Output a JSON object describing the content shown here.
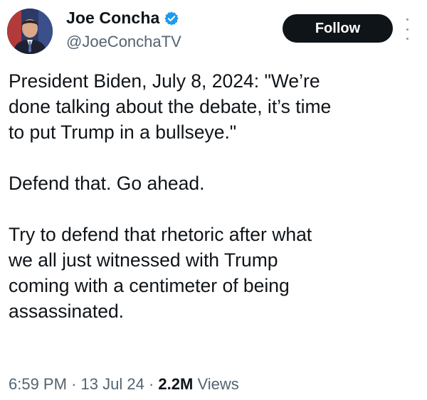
{
  "author": {
    "display_name": "Joe Concha",
    "handle": "@JoeConchaTV",
    "verified": true,
    "verified_color": "#1d9bf0",
    "avatar_icon": "profile-photo"
  },
  "actions": {
    "follow_label": "Follow",
    "more_icon": "more-vertical-icon"
  },
  "tweet": {
    "paragraphs": [
      "President Biden, July 8, 2024: \"We’re\ndone talking about the debate, it’s time\nto put Trump in a bullseye.\"",
      "Defend that. Go ahead.",
      "Try to defend that rhetoric after what\nwe all just witnessed with Trump\ncoming with a centimeter of being\nassassinated."
    ]
  },
  "meta": {
    "time": "6:59 PM",
    "separator": "·",
    "date": "13 Jul 24",
    "views_count": "2.2M",
    "views_label": "Views"
  }
}
